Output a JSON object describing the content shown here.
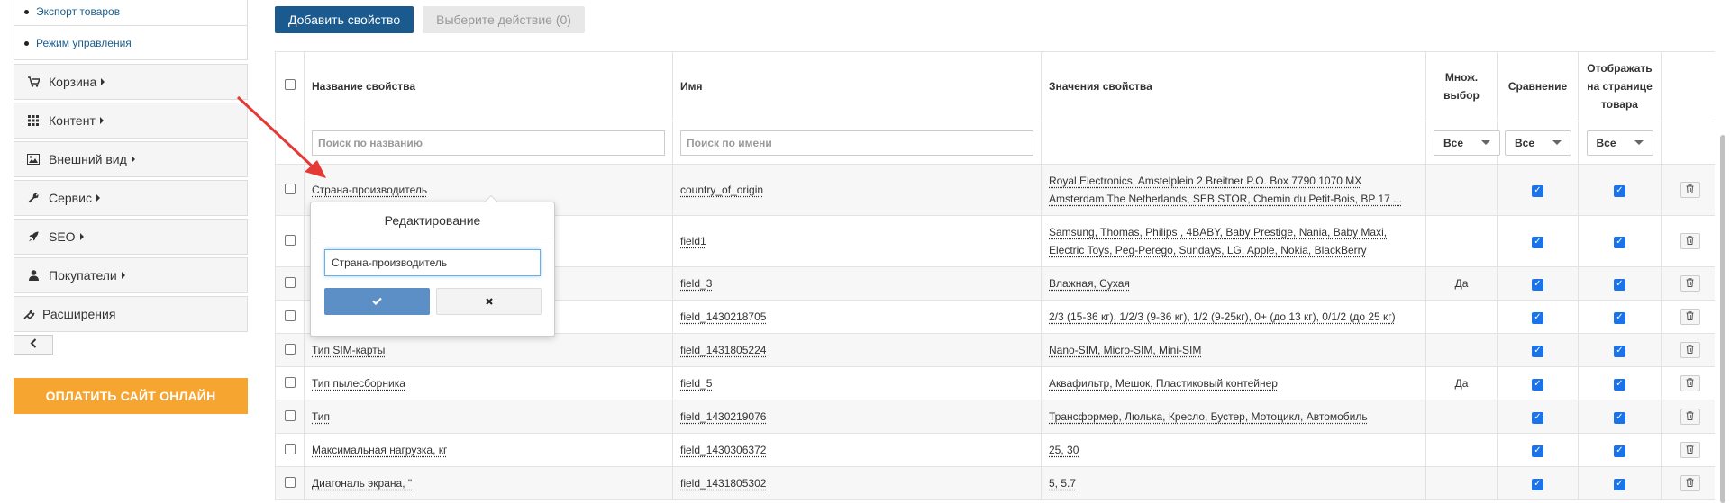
{
  "sidebar": {
    "sub_items": [
      "Экспорт товаров",
      "Режим управления"
    ],
    "menu": [
      {
        "label": "Корзина",
        "icon": "cart-icon",
        "has_caret": true
      },
      {
        "label": "Контент",
        "icon": "grid-icon",
        "has_caret": true
      },
      {
        "label": "Внешний вид",
        "icon": "image-icon",
        "has_caret": true
      },
      {
        "label": "Сервис",
        "icon": "wrench-icon",
        "has_caret": true
      },
      {
        "label": "SEO",
        "icon": "rocket-icon",
        "has_caret": true
      },
      {
        "label": "Покупатели",
        "icon": "user-icon",
        "has_caret": true
      },
      {
        "label": "Расширения",
        "icon": "plug-icon",
        "has_caret": false
      }
    ],
    "collapse_icon": "chevron-left-icon",
    "pay_button": "ОПЛАТИТЬ САЙТ ОНЛАЙН"
  },
  "toolbar": {
    "add_property": "Добавить свойство",
    "choose_action": "Выберите действие (0)"
  },
  "table": {
    "headers": {
      "name": "Название свойства",
      "code": "Имя",
      "values": "Значения свойства",
      "multi": "Множ. выбор",
      "compare": "Сравнение",
      "show_on_page": "Отображать на странице товара"
    },
    "filters": {
      "name_placeholder": "Поиск по названию",
      "code_placeholder": "Поиск по имени",
      "multi": "Все",
      "compare": "Все",
      "show_on_page": "Все"
    },
    "rows": [
      {
        "name": "Страна-производитель",
        "code": "country_of_origin",
        "values": "Royal Electronics, Amstelplein 2 Breitner P.O. Box 7790 1070 MX Amsterdam The Netherlands, SEB STOR, Chemin du Petit-Bois, BP 17 ...",
        "multi": "",
        "compare": true,
        "show": true
      },
      {
        "name": "",
        "code": "field1",
        "values": "Samsung, Thomas, Philips , 4BABY, Baby Prestige, Nania, Baby Maxi, Electric Toys, Peg-Perego, Sundays, LG, Apple, Nokia, BlackBerry",
        "multi": "",
        "compare": true,
        "show": true
      },
      {
        "name": "",
        "code": "field_3",
        "values": "Влажная, Сухая",
        "multi": "Да",
        "compare": true,
        "show": true
      },
      {
        "name": "",
        "code": "field_1430218705",
        "values": "2/3 (15-36 кг), 1/2/3 (9-36 кг), 1/2 (9-25кг), 0+ (до 13 кг), 0/1/2 (до 25 кг)",
        "multi": "",
        "compare": true,
        "show": true
      },
      {
        "name": "Тип SIM-карты",
        "code": "field_1431805224",
        "values": "Nano-SIM, Micro-SIM, Mini-SIM",
        "multi": "",
        "compare": true,
        "show": true
      },
      {
        "name": "Тип пылесборника",
        "code": "field_5",
        "values": "Аквафильтр, Мешок, Пластиковый контейнер",
        "multi": "Да",
        "compare": true,
        "show": true
      },
      {
        "name": "Тип",
        "code": "field_1430219076",
        "values": "Трансформер, Люлька, Кресло, Бустер, Мотоцикл, Автомобиль",
        "multi": "",
        "compare": true,
        "show": true
      },
      {
        "name": "Максимальная нагрузка, кг",
        "code": "field_1430306372",
        "values": "25, 30",
        "multi": "",
        "compare": true,
        "show": true
      },
      {
        "name": "Диагональ экрана, \"",
        "code": "field_1431805302",
        "values": "5, 5.7",
        "multi": "",
        "compare": true,
        "show": true
      }
    ]
  },
  "popover": {
    "title": "Редактирование",
    "input_value": "Страна-производитель",
    "ok_icon": "check-icon",
    "cancel_icon": "times-icon"
  },
  "colors": {
    "primary": "#1b5a8e",
    "pay": "#f7a531",
    "checkbox": "#1a73e8",
    "annotation_arrow": "#e53935"
  }
}
